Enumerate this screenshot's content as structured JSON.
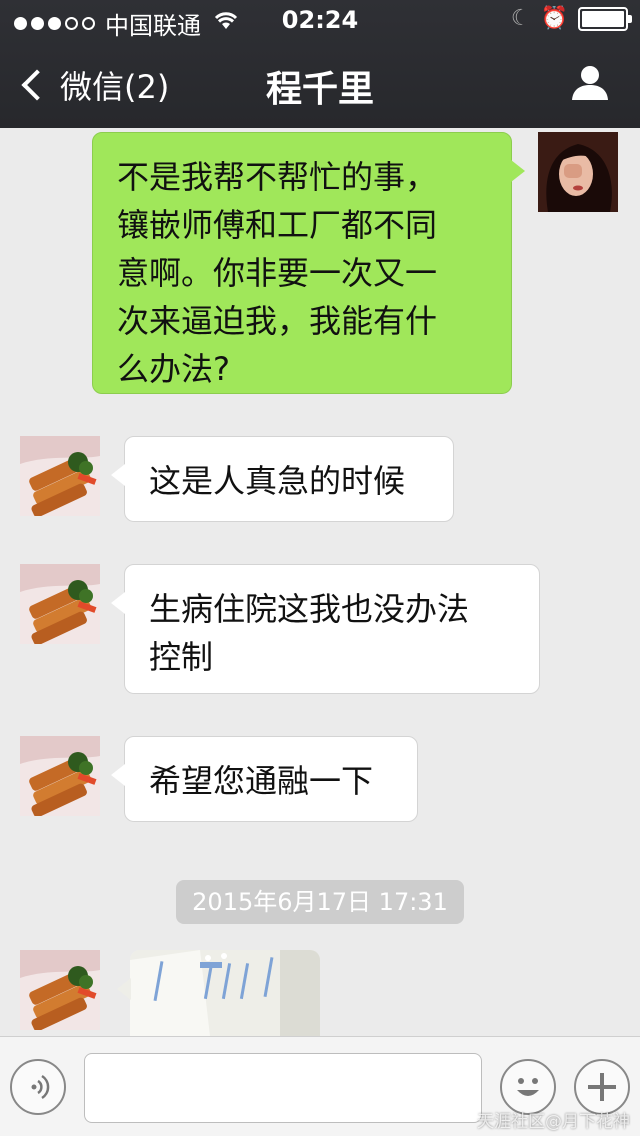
{
  "status_bar": {
    "carrier": "中国联通",
    "time": "02:24"
  },
  "nav": {
    "back_label": "微信(2)",
    "title": "程千里"
  },
  "messages": [
    {
      "sender": "me",
      "text": "不是我帮不帮忙的事，\n镶嵌师傅和工厂都不同\n意啊。你非要一次又一\n次来逼迫我，我能有什\n么办法?"
    },
    {
      "sender": "contact",
      "text": "这是人真急的时候"
    },
    {
      "sender": "contact",
      "text": "生病住院这我也没办法\n控制"
    },
    {
      "sender": "contact",
      "text": "希望您通融一下"
    }
  ],
  "timestamp": "2015年6月17日  17:31",
  "input": {
    "value": "",
    "placeholder": ""
  },
  "watermark": "天涯社区@月下花神",
  "colors": {
    "nav_bg": "#2c2d31",
    "chat_bg": "#ebebeb",
    "my_bubble": "#a0e75a",
    "their_bubble": "#ffffff"
  },
  "icons": {
    "voice": "voice-icon",
    "emoji": "emoji-icon",
    "plus": "plus-icon",
    "profile": "person-icon"
  }
}
